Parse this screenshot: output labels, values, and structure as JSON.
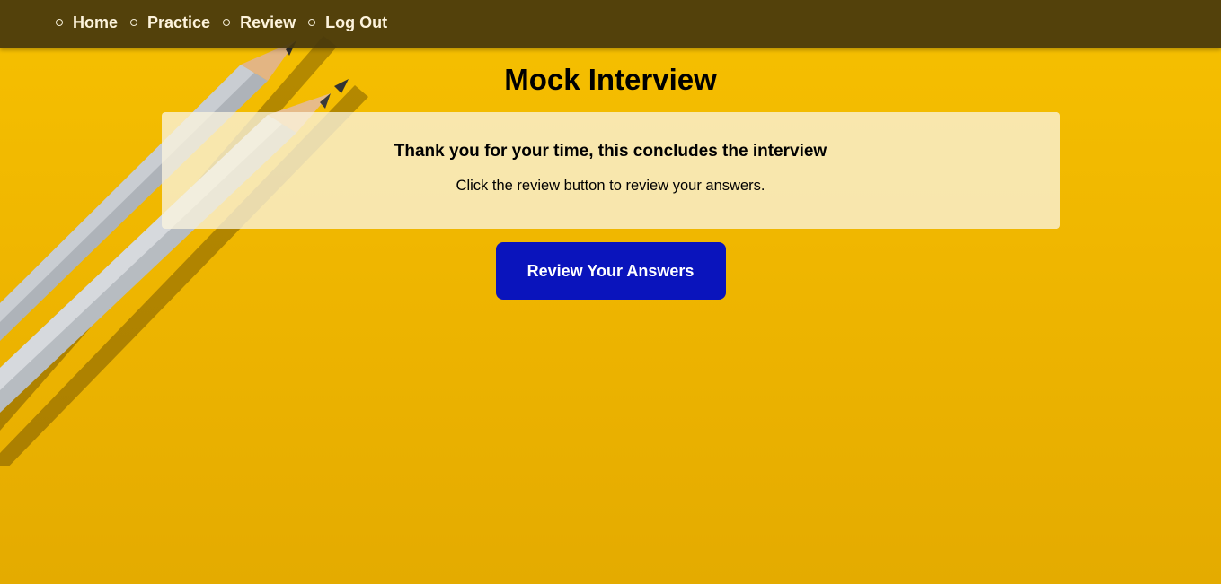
{
  "nav": {
    "items": [
      {
        "label": "Home"
      },
      {
        "label": "Practice"
      },
      {
        "label": "Review"
      },
      {
        "label": "Log Out"
      }
    ]
  },
  "main": {
    "title": "Mock Interview",
    "card": {
      "heading": "Thank you for your time, this concludes the interview",
      "text": "Click the review button to review your answers."
    },
    "review_button_label": "Review Your Answers"
  },
  "colors": {
    "background": "#f4bd00",
    "navbar": "#46370c",
    "button": "#0a14bc"
  }
}
